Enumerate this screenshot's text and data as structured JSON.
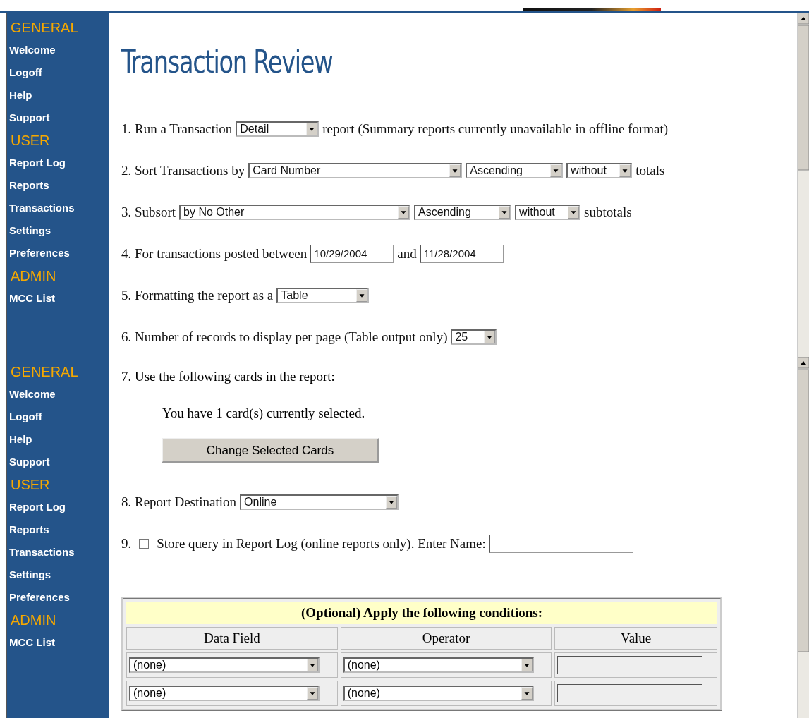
{
  "sidebar_menus": [
    {
      "sections": [
        {
          "heading": "GENERAL",
          "items": [
            "Welcome",
            "Logoff",
            "Help",
            "Support"
          ]
        },
        {
          "heading": "USER",
          "items": [
            "Report Log",
            "Reports",
            "Transactions",
            "Settings",
            "Preferences"
          ]
        },
        {
          "heading": "ADMIN",
          "items": [
            "MCC List"
          ]
        }
      ]
    },
    {
      "sections": [
        {
          "heading": "GENERAL",
          "items": [
            "Welcome",
            "Logoff",
            "Help",
            "Support"
          ]
        },
        {
          "heading": "USER",
          "items": [
            "Report Log",
            "Reports",
            "Transactions",
            "Settings",
            "Preferences"
          ]
        },
        {
          "heading": "ADMIN",
          "items": [
            "MCC List"
          ]
        }
      ]
    }
  ],
  "title": "Transaction Review",
  "steps": [
    {
      "kind": "line",
      "parts": [
        {
          "kind": "text",
          "text": "1. Run a Transaction"
        },
        {
          "kind": "select",
          "value": "Detail"
        },
        {
          "kind": "text",
          "text": "report (Summary reports currently unavailable in offline format)"
        }
      ]
    },
    {
      "kind": "line",
      "parts": [
        {
          "kind": "text",
          "text": "2. Sort Transactions by"
        },
        {
          "kind": "select",
          "value": "Card Number"
        },
        {
          "kind": "select",
          "value": "Ascending"
        },
        {
          "kind": "select",
          "value": "without"
        },
        {
          "kind": "text",
          "text": "totals"
        }
      ]
    },
    {
      "kind": "line",
      "parts": [
        {
          "kind": "text",
          "text": "3. Subsort"
        },
        {
          "kind": "select",
          "value": "by No Other"
        },
        {
          "kind": "select",
          "value": "Ascending"
        },
        {
          "kind": "select",
          "value": "without"
        },
        {
          "kind": "text",
          "text": "subtotals"
        }
      ]
    },
    {
      "kind": "line",
      "parts": [
        {
          "kind": "text",
          "text": "4. For transactions posted between"
        },
        {
          "kind": "input",
          "value": "10/29/2004"
        },
        {
          "kind": "text",
          "text": "and"
        },
        {
          "kind": "input",
          "value": "11/28/2004"
        }
      ]
    },
    {
      "kind": "line",
      "parts": [
        {
          "kind": "text",
          "text": "5. Formatting the report as a"
        },
        {
          "kind": "select",
          "value": "Table"
        }
      ]
    },
    {
      "kind": "line",
      "parts": [
        {
          "kind": "text",
          "text": "6. Number of records to display per page (Table output only)"
        },
        {
          "kind": "select",
          "value": "25"
        }
      ]
    },
    {
      "kind": "cards",
      "label": "7. Use the following cards in the report:",
      "note": "You have 1 card(s) currently selected.",
      "button": "Change Selected Cards"
    },
    {
      "kind": "line",
      "parts": [
        {
          "kind": "text",
          "text": "8. Report Destination"
        },
        {
          "kind": "select",
          "value": "Online"
        }
      ]
    },
    {
      "kind": "store",
      "number": "9.",
      "checked": false,
      "label": "Store query in Report Log (online reports only). Enter Name:"
    }
  ],
  "conditions": {
    "title": "(Optional) Apply the following conditions:",
    "columns": [
      "Data Field",
      "Operator",
      "Value"
    ],
    "rows": [
      {
        "field": "(none)",
        "operator": "(none)"
      },
      {
        "field": "(none)",
        "operator": "(none)"
      }
    ]
  }
}
